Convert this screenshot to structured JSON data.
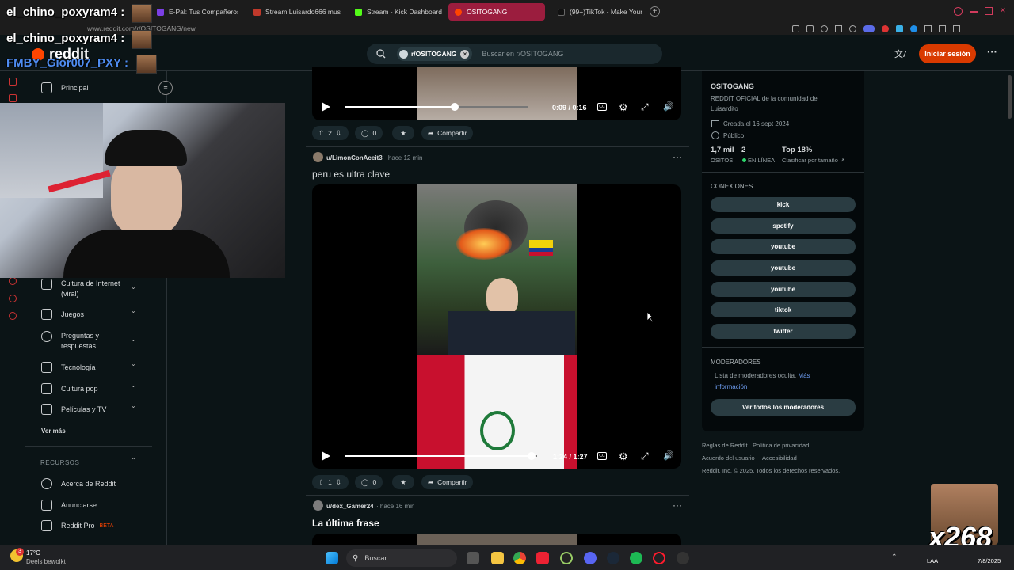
{
  "chat": {
    "lines": [
      {
        "user": "el_chino_poxyram4 :"
      },
      {
        "user": "el_chino_poxyram4 :"
      },
      {
        "user": "FMBY_Gior007_PXY :"
      }
    ]
  },
  "browser": {
    "tabs": [
      {
        "label": "E-Pal: Tus Compañeros A"
      },
      {
        "label": "Stream Luisardo666 mus"
      },
      {
        "label": "Stream - Kick Dashboard"
      },
      {
        "label": "OSITOGANG"
      },
      {
        "label": "(99+)TikTok - Make Your"
      }
    ],
    "url": "www.reddit.com/r/OSITOGANG/new"
  },
  "reddit": {
    "logo_text": "reddit",
    "search_chip": "r/OSITOGANG",
    "search_placeholder": "Buscar en r/OSITOGANG",
    "login_label": "Iniciar sesión"
  },
  "sidebar": {
    "principal": "Principal",
    "topics": [
      {
        "label": "Cultura de Internet (viral)"
      },
      {
        "label": "Juegos"
      },
      {
        "label": "Preguntas y respuestas"
      },
      {
        "label": "Tecnología"
      },
      {
        "label": "Cultura pop"
      },
      {
        "label": "Películas y TV"
      }
    ],
    "see_more": "Ver más",
    "resources_heading": "RECURSOS",
    "resources": [
      {
        "label": "Acerca de Reddit"
      },
      {
        "label": "Anunciarse"
      },
      {
        "label": "Reddit Pro"
      }
    ],
    "beta_badge": "BETA"
  },
  "posts": [
    {
      "time_display": "0:09 / 0:16",
      "progress": 0.6,
      "votes": "2",
      "comments": "0",
      "share": "Compartir"
    },
    {
      "user": "u/LimonConAceit3",
      "age": "hace 12 min",
      "title": "peru es ultra clave",
      "time_display": "1:24 / 1:27",
      "progress": 0.97,
      "votes": "1",
      "comments": "0",
      "share": "Compartir"
    },
    {
      "user": "u/dex_Gamer24",
      "age": "hace 16 min",
      "title": "La última frase"
    }
  ],
  "community": {
    "name": "OSITOGANG",
    "description": "REDDIT OFICIAL de la comunidad de Luisardito",
    "created": "Creada el 16 sept 2024",
    "visibility": "Público",
    "members": "1,7 mil",
    "members_label": "OSITOS",
    "online": "2",
    "online_label": "EN LÍNEA",
    "rank": "Top 18%",
    "rank_label": "Clasificar por tamaño",
    "connections_heading": "CONEXIONES",
    "connections": [
      "kick",
      "spotify",
      "youtube",
      "youtube",
      "youtube",
      "tiktok",
      "twitter"
    ],
    "moderators_heading": "MODERADORES",
    "moderators_text": "Lista de moderadores oculta.",
    "moderators_link": "Más información",
    "moderators_button": "Ver todos los moderadores"
  },
  "footer": {
    "links": [
      "Reglas de Reddit",
      "Política de privacidad",
      "Acuerdo del usuario",
      "Accesibilidad"
    ],
    "copyright": "Reddit, Inc. © 2025. Todos los derechos reservados."
  },
  "taskbar": {
    "weather_temp": "17°C",
    "weather_desc": "Deels bewolkt",
    "search_label": "Buscar",
    "lang": "LAA",
    "date": "7/8/2025",
    "badge": "3"
  },
  "overlay_counter": "x268",
  "colors": {
    "accent": "#d93a00",
    "active_tab": "#9b1d3e",
    "background": "#0b1416"
  }
}
